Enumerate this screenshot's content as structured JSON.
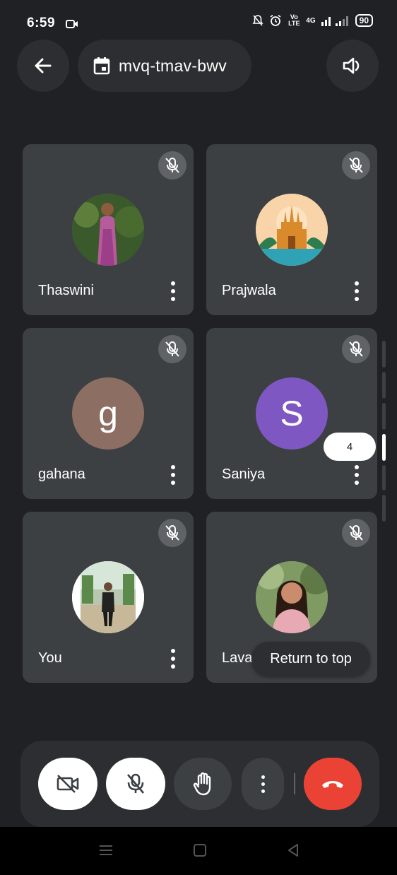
{
  "status_bar": {
    "time": "6:59",
    "network_text": "Vo LTE",
    "signal_text": "4G",
    "battery": "90"
  },
  "top_bar": {
    "back_icon": "arrow-left-icon",
    "meeting_code": "mvq-tmav-bwv",
    "calendar_icon": "calendar-icon",
    "speaker_icon": "speaker-icon"
  },
  "participants": [
    {
      "name": "Thaswini",
      "avatar": "photo",
      "muted": true
    },
    {
      "name": "Prajwala",
      "avatar": "photo",
      "muted": true
    },
    {
      "name": "gahana",
      "avatar_letter": "g",
      "avatar_color": "#8d6e63",
      "muted": true
    },
    {
      "name": "Saniya",
      "avatar_letter": "S",
      "avatar_color": "#7e57c2",
      "muted": true
    },
    {
      "name": "You",
      "avatar": "photo",
      "muted": true
    },
    {
      "name": "Lavanya",
      "visible_name": "Lava",
      "avatar": "photo",
      "muted": true
    }
  ],
  "pager": {
    "current_page": "4"
  },
  "return_to_top_label": "Return to top",
  "controls": {
    "camera_icon": "camera-off-icon",
    "mic_icon": "mic-off-icon",
    "hand_icon": "raise-hand-icon",
    "more_icon": "more-vert-icon",
    "end_call_icon": "end-call-icon",
    "end_call_color": "#ea4335"
  },
  "colors": {
    "background": "#202124",
    "tile": "#3c4043",
    "accent_red": "#ea4335"
  }
}
